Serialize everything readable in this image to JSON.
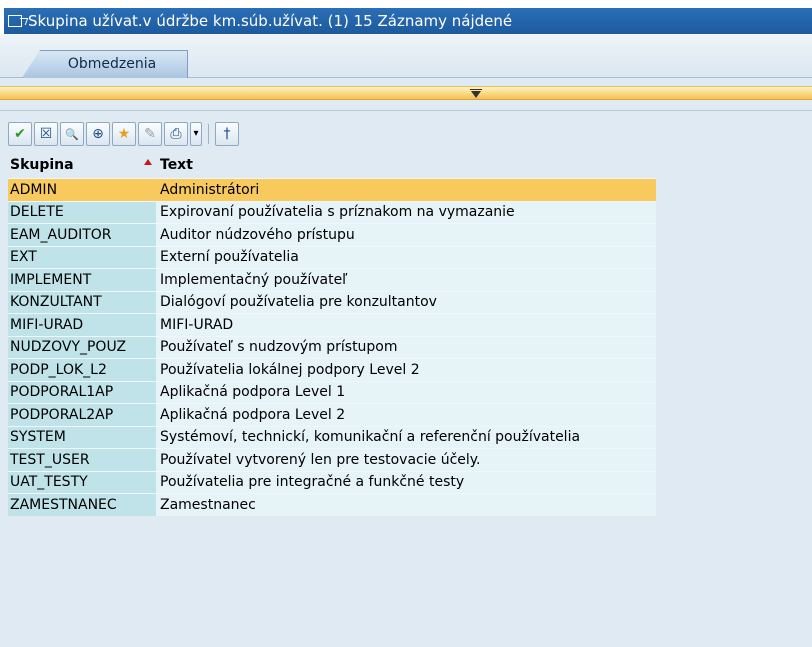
{
  "window": {
    "title": "Skupina užívat.v údržbe km.súb.užívat. (1)   15 Záznamy nájdené"
  },
  "tabs": [
    {
      "label": "Obmedzenia"
    }
  ],
  "toolbar": {
    "buttons": [
      {
        "icon": "check-icon",
        "glyph": "✔"
      },
      {
        "icon": "cancel-icon",
        "glyph": "☒"
      },
      {
        "icon": "find-icon",
        "glyph": "🔍"
      },
      {
        "icon": "find-next-icon",
        "glyph": "⊕"
      },
      {
        "icon": "new-entry-icon",
        "glyph": "★"
      },
      {
        "icon": "personal-list-icon",
        "glyph": "✎"
      },
      {
        "icon": "print-icon",
        "glyph": "⎙"
      },
      {
        "icon": "dropdown-icon",
        "glyph": "▾"
      },
      {
        "icon": "info-icon",
        "glyph": "†"
      }
    ]
  },
  "table": {
    "columns": [
      "Skupina",
      "Text"
    ],
    "selected_index": 0,
    "rows": [
      {
        "key": "ADMIN",
        "text": "Administrátori"
      },
      {
        "key": "DELETE",
        "text": "Expirovaní používatelia s príznakom na vymazanie"
      },
      {
        "key": "EAM_AUDITOR",
        "text": "Auditor núdzového prístupu"
      },
      {
        "key": "EXT",
        "text": "Externí  používatelia"
      },
      {
        "key": "IMPLEMENT",
        "text": "Implementačný používateľ"
      },
      {
        "key": "KONZULTANT",
        "text": "Dialógoví používatelia pre konzultantov"
      },
      {
        "key": "MIFI-URAD",
        "text": "MIFI-URAD"
      },
      {
        "key": "NUDZOVY_POUZ",
        "text": "Používateľ s nudzovým prístupom"
      },
      {
        "key": "PODP_LOK_L2",
        "text": "Používatelia lokálnej podpory Level 2"
      },
      {
        "key": "PODPORAL1AP",
        "text": "Aplikačná podpora Level 1"
      },
      {
        "key": "PODPORAL2AP",
        "text": "Aplikačná podpora Level 2"
      },
      {
        "key": "SYSTEM",
        "text": "Systémoví, technickí, komunikační a referenční používatelia"
      },
      {
        "key": "TEST_USER",
        "text": "Používatel vytvorený len pre testovacie účely."
      },
      {
        "key": "UAT_TESTY",
        "text": "Používatelia pre integračné a funkčné testy"
      },
      {
        "key": "ZAMESTNANEC",
        "text": "Zamestnanec"
      }
    ]
  },
  "colors": {
    "selected_row": "#f8c95c",
    "key_column": "#bfe3e9",
    "text_column": "#e6f3f7",
    "title_bar": "#1d5a9c"
  }
}
